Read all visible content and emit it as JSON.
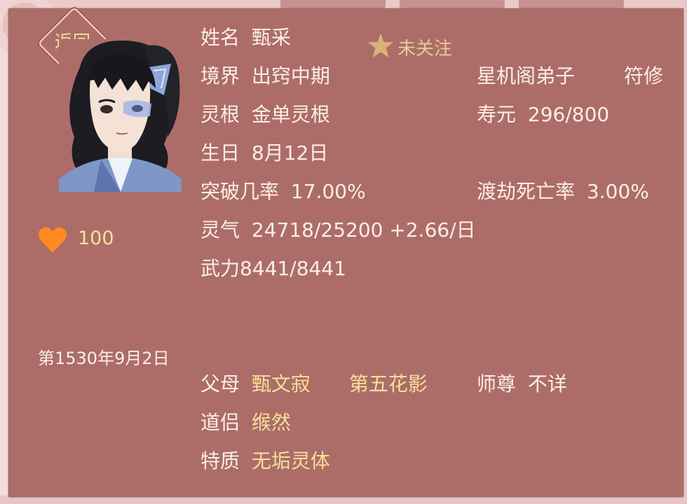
{
  "back_label": "返回",
  "profile": {
    "name_label": "姓名",
    "name": "甄采",
    "follow_label": "未关注",
    "realm_label": "境界",
    "realm": "出窍中期",
    "sect": "星机阁弟子",
    "profession": "符修",
    "root_label": "灵根",
    "root": "金单灵根",
    "lifespan_label": "寿元",
    "lifespan": "296/800",
    "birthday_label": "生日",
    "birthday": "8月12日",
    "breakthrough_label": "突破几率",
    "breakthrough": "17.00%",
    "tribulation_label": "渡劫死亡率",
    "tribulation": "3.00%",
    "qi_label": "灵气",
    "qi": "24718/25200 +2.66/日",
    "power_label": "武力",
    "power": "8441/8441"
  },
  "affection": {
    "value": "100",
    "icon": "heart-icon",
    "color": "#ff8a1f"
  },
  "game_date": "第1530年9月2日",
  "relations": {
    "parents_label": "父母",
    "father": "甄文寂",
    "mother": "第五花影",
    "master_label": "师尊",
    "master": "不详",
    "partner_label": "道侣",
    "partner": "缑然",
    "trait_label": "特质",
    "trait": "无垢灵体"
  },
  "colors": {
    "panel": "#ac6d68",
    "gold_text": "#f7df9b",
    "text": "#fbeee6"
  }
}
